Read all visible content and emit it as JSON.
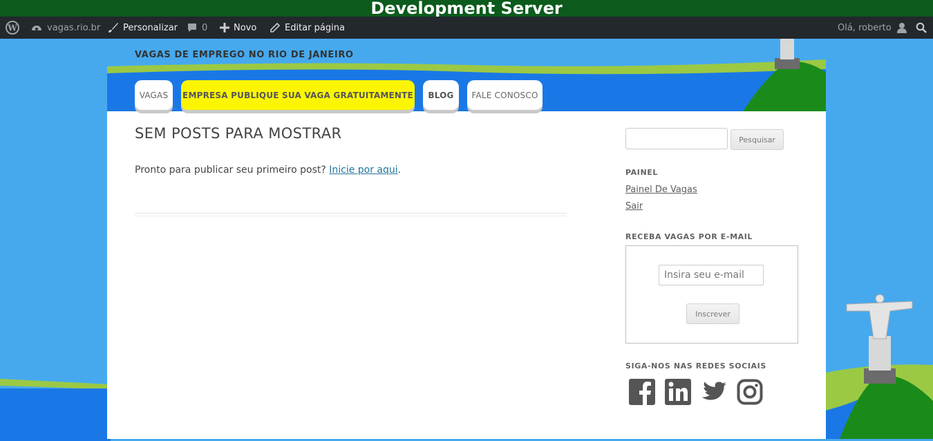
{
  "dev_banner": "Development Server",
  "admin_bar": {
    "site_name": "vagas.rio.br",
    "customize": "Personalizar",
    "comments_count": "0",
    "new": "Novo",
    "edit_page": "Editar página",
    "greeting": "Olá, roberto"
  },
  "site": {
    "tagline": "VAGAS DE EMPREGO NO RIO DE JANEIRO",
    "nav": [
      "VAGAS",
      "EMPRESA PUBLIQUE SUA VAGA GRATUITAMENTE",
      "BLOG",
      "FALE CONOSCO"
    ]
  },
  "content": {
    "title": "SEM POSTS PARA MOSTRAR",
    "message": "Pronto para publicar seu primeiro post?",
    "link": "Inicie por aqui",
    "trailing": "."
  },
  "sidebar": {
    "search_button": "Pesquisar",
    "panel_title": "PAINEL",
    "panel_links": [
      "Painel De Vagas",
      "Sair"
    ],
    "subscribe_title": "RECEBA VAGAS POR E-MAIL",
    "email_placeholder": "Insira seu e-mail",
    "subscribe_button": "Inscrever",
    "social_title": "SIGA-NOS NAS REDES SOCIAIS",
    "social_icons": [
      "facebook-icon",
      "linkedin-icon",
      "twitter-icon",
      "instagram-icon"
    ]
  },
  "colors": {
    "dev_banner_bg": "#0c5b1c",
    "admin_bar_bg": "#23282d",
    "sky": "#46a9ee",
    "nav_highlight": "#fbf600",
    "link": "#21759b"
  }
}
